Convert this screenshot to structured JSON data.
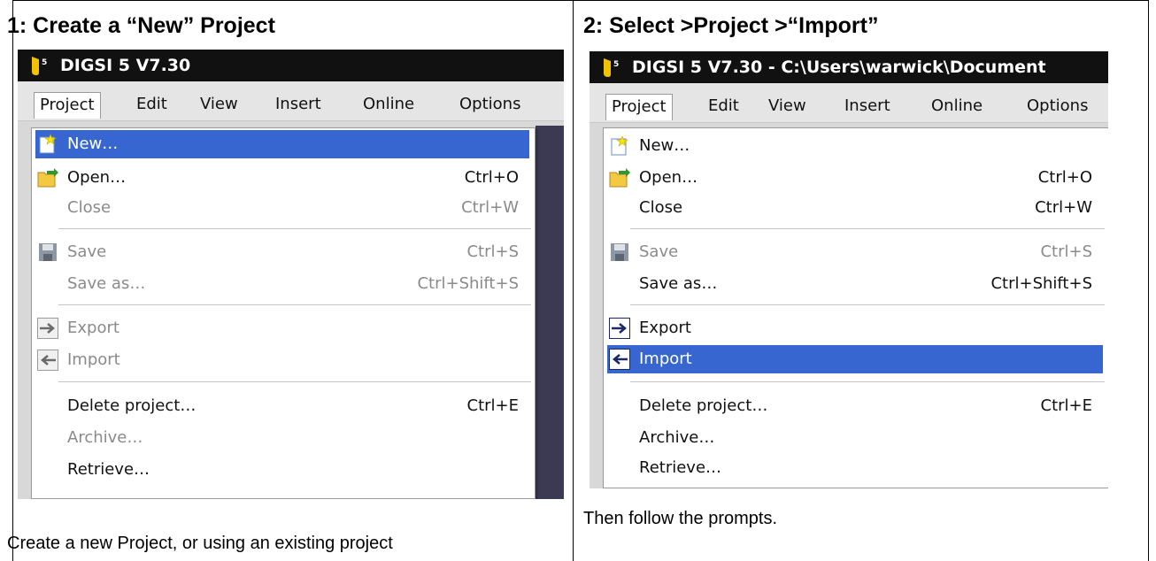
{
  "steps": [
    {
      "title": "1: Create a “New” Project",
      "caption": "Create a new Project, or using an existing project",
      "window_title": "DIGSI 5 V7.30",
      "menus": [
        "Project",
        "Edit",
        "View",
        "Insert",
        "Online",
        "Options"
      ],
      "items": [
        {
          "label": "New…",
          "shortcut": ""
        },
        {
          "label": "Open…",
          "shortcut": "Ctrl+O"
        },
        {
          "label": "Close",
          "shortcut": "Ctrl+W"
        },
        {
          "label": "Save",
          "shortcut": "Ctrl+S"
        },
        {
          "label": "Save as…",
          "shortcut": "Ctrl+Shift+S"
        },
        {
          "label": "Export",
          "shortcut": ""
        },
        {
          "label": "Import",
          "shortcut": ""
        },
        {
          "label": "Delete project…",
          "shortcut": "Ctrl+E"
        },
        {
          "label": "Archive…",
          "shortcut": ""
        },
        {
          "label": "Retrieve…",
          "shortcut": ""
        }
      ]
    },
    {
      "title": "2: Select >Project >“Import”",
      "caption": "Then follow the prompts.",
      "window_title": "DIGSI 5 V7.30 - C:\\Users\\warwick\\Document",
      "menus": [
        "Project",
        "Edit",
        "View",
        "Insert",
        "Online",
        "Options"
      ],
      "items": [
        {
          "label": "New…",
          "shortcut": ""
        },
        {
          "label": "Open…",
          "shortcut": "Ctrl+O"
        },
        {
          "label": "Close",
          "shortcut": "Ctrl+W"
        },
        {
          "label": "Save",
          "shortcut": "Ctrl+S"
        },
        {
          "label": "Save as…",
          "shortcut": "Ctrl+Shift+S"
        },
        {
          "label": "Export",
          "shortcut": ""
        },
        {
          "label": "Import",
          "shortcut": ""
        },
        {
          "label": "Delete project…",
          "shortcut": "Ctrl+E"
        },
        {
          "label": "Archive…",
          "shortcut": ""
        },
        {
          "label": "Retrieve…",
          "shortcut": ""
        }
      ]
    }
  ],
  "colors": {
    "highlight": "#3766d1",
    "titlebar": "#111111",
    "disabled": "#8a8a8a"
  }
}
